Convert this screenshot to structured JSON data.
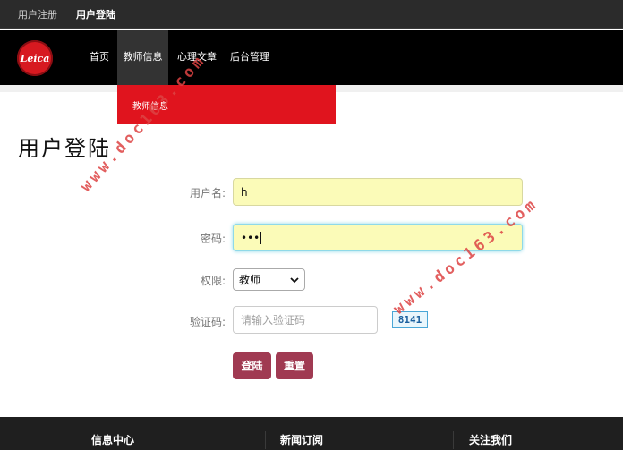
{
  "topbar": {
    "register_label": "用户注册",
    "login_label": "用户登陆"
  },
  "logo": {
    "text": "Leica"
  },
  "nav": [
    {
      "label": "首页"
    },
    {
      "label": "教师信息"
    },
    {
      "label": "心理文章"
    },
    {
      "label": "后台管理"
    }
  ],
  "dropdown": {
    "item": "教师信息"
  },
  "page": {
    "title": "用户登陆"
  },
  "form": {
    "username_label": "用户名:",
    "username_value": "h",
    "password_label": "密码:",
    "password_value": "•••",
    "role_label": "权限:",
    "role_value": "教师",
    "captcha_label": "验证码:",
    "captcha_placeholder": "请输入验证码",
    "captcha_code": "8141",
    "login_button": "登陆",
    "reset_button": "重置"
  },
  "footer": {
    "col1": "信息中心",
    "col2": "新闻订阅",
    "col3": "关注我们"
  },
  "watermark": {
    "text": "www.doc163.com"
  },
  "colors": {
    "accent_red": "#e0141e",
    "button": "#a03a52",
    "header_bg": "#000000"
  }
}
